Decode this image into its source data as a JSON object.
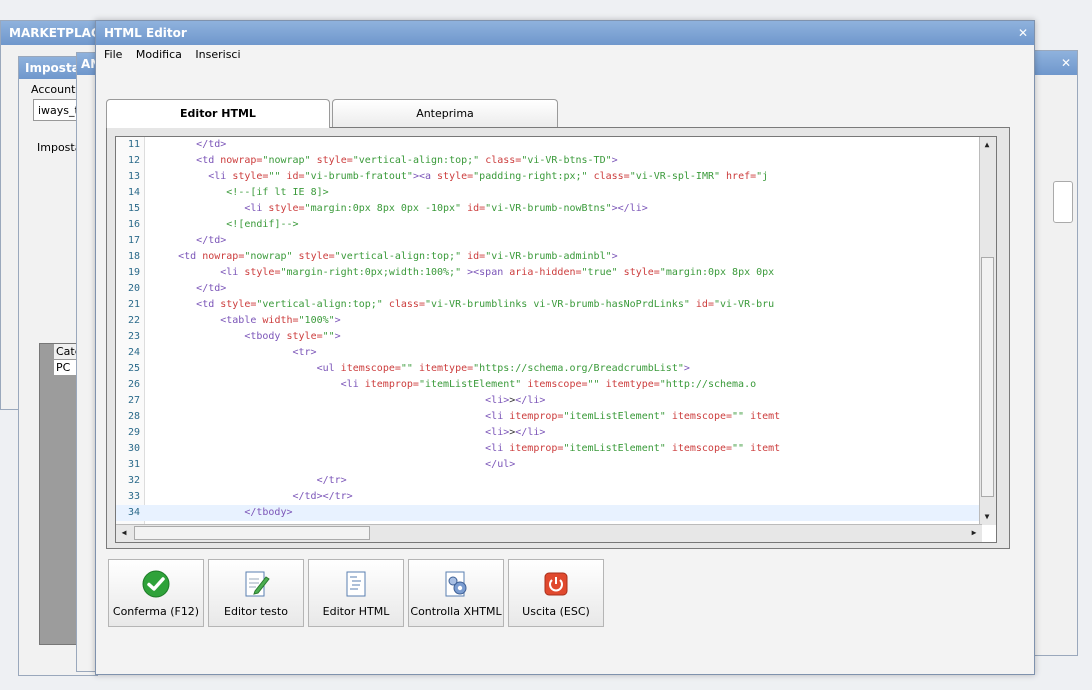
{
  "background_windows": {
    "marketplace_title": "MARKETPLACE",
    "impostazioni_title": "Imposta",
    "an_title": "AN",
    "account_label": "Account",
    "account_value": "iways_t",
    "impostazioni_tab": "Imposta",
    "grid_header": "Cate",
    "grid_cell": "PC"
  },
  "editor": {
    "title": "HTML Editor",
    "menu": [
      "File",
      "Modifica",
      "Inserisci"
    ],
    "tabs": [
      {
        "label": "Editor HTML",
        "active": true
      },
      {
        "label": "Anteprima",
        "active": false
      }
    ],
    "code_lines": [
      {
        "n": "11",
        "parts": [
          [
            "tg",
            "</td>"
          ]
        ],
        "indent": 8
      },
      {
        "n": "12",
        "parts": [
          [
            "tg",
            "<td "
          ],
          [
            "at",
            "nowrap="
          ],
          [
            "va",
            "\"nowrap\" "
          ],
          [
            "at",
            "style="
          ],
          [
            "va",
            "\"vertical-align:top;\" "
          ],
          [
            "at",
            "class="
          ],
          [
            "va",
            "\"vi-VR-btns-TD\""
          ],
          [
            "tg",
            ">"
          ]
        ],
        "indent": 8
      },
      {
        "n": "13",
        "parts": [
          [
            "tg",
            "<li "
          ],
          [
            "at",
            "style="
          ],
          [
            "va",
            "\"\"  "
          ],
          [
            "at",
            "id="
          ],
          [
            "va",
            "\"vi-brumb-fratout\""
          ],
          [
            "tg",
            "><a "
          ],
          [
            "at",
            "style="
          ],
          [
            "va",
            "\"padding-right:px;\" "
          ],
          [
            "at",
            "class="
          ],
          [
            "va",
            "\"vi-VR-spl-IMR\" "
          ],
          [
            "at",
            "href="
          ],
          [
            "va",
            "\"j"
          ]
        ],
        "indent": 10
      },
      {
        "n": "14",
        "parts": [
          [
            "cm",
            "<!--[if lt IE 8]>"
          ]
        ],
        "indent": 13
      },
      {
        "n": "15",
        "parts": [
          [
            "tg",
            "<li  "
          ],
          [
            "at",
            "style="
          ],
          [
            "va",
            "\"margin:0px 8px 0px -10px\"  "
          ],
          [
            "at",
            "id="
          ],
          [
            "va",
            "\"vi-VR-brumb-nowBtns\""
          ],
          [
            "tg",
            "></li>"
          ]
        ],
        "indent": 16
      },
      {
        "n": "16",
        "parts": [
          [
            "cm",
            "<![endif]-->"
          ]
        ],
        "indent": 13
      },
      {
        "n": "17",
        "parts": [
          [
            "tg",
            "</td>"
          ]
        ],
        "indent": 8
      },
      {
        "n": "18",
        "parts": [
          [
            "tg",
            "<td  "
          ],
          [
            "at",
            "nowrap="
          ],
          [
            "va",
            "\"nowrap\" "
          ],
          [
            "at",
            "style="
          ],
          [
            "va",
            "\"vertical-align:top;\" "
          ],
          [
            "at",
            "id="
          ],
          [
            "va",
            "\"vi-VR-brumb-adminbl\""
          ],
          [
            "tg",
            ">"
          ]
        ],
        "indent": 5
      },
      {
        "n": "19",
        "parts": [
          [
            "tg",
            "<li "
          ],
          [
            "at",
            "style="
          ],
          [
            "va",
            "\"margin-right:0px;width:100%;\" "
          ],
          [
            "tg",
            "><span "
          ],
          [
            "at",
            "aria-hidden="
          ],
          [
            "va",
            "\"true\" "
          ],
          [
            "at",
            "style="
          ],
          [
            "va",
            "\"margin:0px 8px 0px"
          ]
        ],
        "indent": 12
      },
      {
        "n": "20",
        "parts": [
          [
            "tg",
            "</td>"
          ]
        ],
        "indent": 8
      },
      {
        "n": "21",
        "parts": [
          [
            "tg",
            "<td "
          ],
          [
            "at",
            "style="
          ],
          [
            "va",
            "\"vertical-align:top;\" "
          ],
          [
            "at",
            "class="
          ],
          [
            "va",
            "\"vi-VR-brumblinks vi-VR-brumb-hasNoPrdLinks\"  "
          ],
          [
            "at",
            "id="
          ],
          [
            "va",
            "\"vi-VR-bru"
          ]
        ],
        "indent": 8
      },
      {
        "n": "22",
        "parts": [
          [
            "tg",
            "<table "
          ],
          [
            "at",
            "width="
          ],
          [
            "va",
            "\"100%\""
          ],
          [
            "tg",
            ">"
          ]
        ],
        "indent": 12
      },
      {
        "n": "23",
        "parts": [
          [
            "tg",
            "<tbody "
          ],
          [
            "at",
            "style="
          ],
          [
            "va",
            "\"\""
          ],
          [
            "tg",
            ">"
          ]
        ],
        "indent": 16
      },
      {
        "n": "24",
        "parts": [
          [
            "tg",
            "<tr>"
          ]
        ],
        "indent": 24
      },
      {
        "n": "25",
        "parts": [
          [
            "tg",
            "<ul "
          ],
          [
            "at",
            "itemscope="
          ],
          [
            "va",
            "\"\" "
          ],
          [
            "at",
            "itemtype="
          ],
          [
            "va",
            "\"https://schema.org/BreadcrumbList\""
          ],
          [
            "tg",
            ">"
          ]
        ],
        "indent": 28
      },
      {
        "n": "26",
        "parts": [
          [
            "tg",
            "<li "
          ],
          [
            "at",
            "itemprop="
          ],
          [
            "va",
            "\"itemListElement\" "
          ],
          [
            "at",
            "itemscope="
          ],
          [
            "va",
            "\"\" "
          ],
          [
            "at",
            "itemtype="
          ],
          [
            "va",
            "\"http://schema.o"
          ]
        ],
        "indent": 32
      },
      {
        "n": "27",
        "parts": [
          [
            "tg",
            "<li>"
          ],
          [
            "tx",
            "&gt;"
          ],
          [
            "tg",
            "</li>"
          ]
        ],
        "indent": 56
      },
      {
        "n": "28",
        "parts": [
          [
            "tg",
            "<li "
          ],
          [
            "at",
            "itemprop="
          ],
          [
            "va",
            "\"itemListElement\" "
          ],
          [
            "at",
            "itemscope="
          ],
          [
            "va",
            "\"\" "
          ],
          [
            "at",
            "itemt"
          ]
        ],
        "indent": 56
      },
      {
        "n": "29",
        "parts": [
          [
            "tg",
            "<li>"
          ],
          [
            "tx",
            "&gt;"
          ],
          [
            "tg",
            "</li>"
          ]
        ],
        "indent": 56
      },
      {
        "n": "30",
        "parts": [
          [
            "tg",
            "<li "
          ],
          [
            "at",
            "itemprop="
          ],
          [
            "va",
            "\"itemListElement\" "
          ],
          [
            "at",
            "itemscope="
          ],
          [
            "va",
            "\"\" "
          ],
          [
            "at",
            "itemt"
          ]
        ],
        "indent": 56
      },
      {
        "n": "31",
        "parts": [
          [
            "tg",
            "</ul>"
          ]
        ],
        "indent": 56
      },
      {
        "n": "32",
        "parts": [
          [
            "tg",
            "</tr>"
          ]
        ],
        "indent": 28
      },
      {
        "n": "33",
        "parts": [
          [
            "tg",
            "</td></tr>"
          ]
        ],
        "indent": 24
      },
      {
        "n": "34",
        "parts": [
          [
            "tg",
            "</tbody>"
          ]
        ],
        "indent": 16
      }
    ],
    "current_line": "34"
  },
  "toolbar": [
    {
      "name": "confirm-button",
      "label": "Conferma (F12)",
      "icon": "check-icon"
    },
    {
      "name": "text-editor-button",
      "label": "Editor testo",
      "icon": "pencil-document-icon"
    },
    {
      "name": "html-editor-button",
      "label": "Editor HTML",
      "icon": "code-document-icon"
    },
    {
      "name": "check-xhtml-button",
      "label": "Controlla XHTML",
      "icon": "gear-document-icon"
    },
    {
      "name": "exit-button",
      "label": "Uscita (ESC)",
      "icon": "power-icon"
    }
  ],
  "colors": {
    "titlebar": "#7ea3d6",
    "accent_green": "#2fa23a",
    "exit_red": "#e0492e"
  }
}
